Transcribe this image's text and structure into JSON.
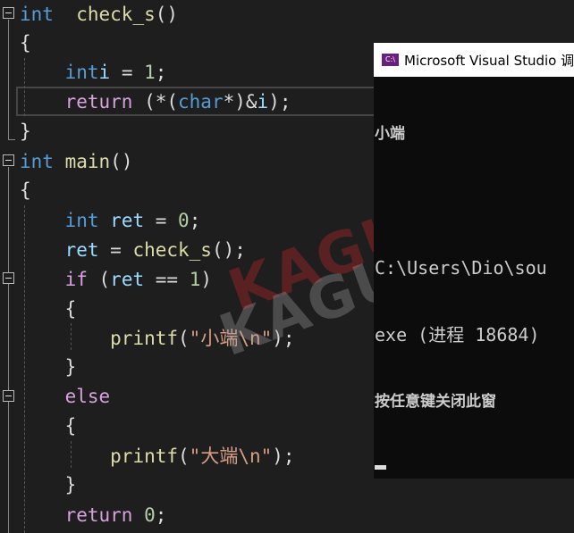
{
  "editor": {
    "lines": [
      [
        [
          "kw",
          "int"
        ],
        [
          "",
          "  "
        ],
        [
          "fn",
          "check_s"
        ],
        [
          "",
          "()"
        ]
      ],
      [
        [
          "",
          "{"
        ]
      ],
      [
        [
          "",
          "    "
        ],
        [
          "kw",
          "int"
        ],
        [
          "",
          "",
          " "
        ],
        [
          "var",
          "i"
        ],
        [
          "",
          " = "
        ],
        [
          "num",
          "1"
        ],
        [
          "",
          ";"
        ]
      ],
      [
        [
          "",
          "    "
        ],
        [
          "ctl",
          "return"
        ],
        [
          "",
          " (*("
        ],
        [
          "kw",
          "char"
        ],
        [
          "",
          "*)&"
        ],
        [
          "var",
          "i"
        ],
        [
          "",
          ");"
        ]
      ],
      [
        [
          "",
          "}"
        ]
      ],
      [
        [
          "kw",
          "int"
        ],
        [
          "",
          " "
        ],
        [
          "fn",
          "main"
        ],
        [
          "",
          "()"
        ]
      ],
      [
        [
          "",
          "{"
        ]
      ],
      [
        [
          "",
          "    "
        ],
        [
          "kw",
          "int"
        ],
        [
          "",
          " "
        ],
        [
          "var",
          "ret"
        ],
        [
          "",
          " = "
        ],
        [
          "num",
          "0"
        ],
        [
          "",
          ";"
        ]
      ],
      [
        [
          "",
          "    "
        ],
        [
          "var",
          "ret"
        ],
        [
          "",
          " = "
        ],
        [
          "fn",
          "check_s"
        ],
        [
          "",
          "();"
        ]
      ],
      [
        [
          "",
          "    "
        ],
        [
          "ctl",
          "if"
        ],
        [
          "",
          " ("
        ],
        [
          "var",
          "ret"
        ],
        [
          "",
          " == "
        ],
        [
          "num",
          "1"
        ],
        [
          "",
          ")"
        ]
      ],
      [
        [
          "",
          "    {"
        ]
      ],
      [
        [
          "",
          "        "
        ],
        [
          "fn",
          "printf"
        ],
        [
          "",
          "("
        ],
        [
          "str",
          "\"小端\\n\""
        ],
        [
          "",
          ");"
        ]
      ],
      [
        [
          "",
          "    }"
        ]
      ],
      [
        [
          "",
          "    "
        ],
        [
          "ctl",
          "else"
        ]
      ],
      [
        [
          "",
          "    {"
        ]
      ],
      [
        [
          "",
          "        "
        ],
        [
          "fn",
          "printf"
        ],
        [
          "",
          "("
        ],
        [
          "str",
          "\"大端\\n\""
        ],
        [
          "",
          ");"
        ]
      ],
      [
        [
          "",
          "    }"
        ]
      ],
      [
        [
          "",
          "    "
        ],
        [
          "ctl",
          "return"
        ],
        [
          "",
          " "
        ],
        [
          "num",
          "0"
        ],
        [
          "",
          ";"
        ]
      ]
    ],
    "watermark": "KAGUYA"
  },
  "console": {
    "title": "Microsoft Visual Studio 调",
    "icon": "visual-studio-console-icon",
    "output": [
      "小端",
      "",
      "C:\\Users\\Dio\\sou",
      "exe (进程 18684)",
      "按任意键关闭此窗"
    ]
  },
  "colors": {
    "keyword": "#569cd6",
    "function": "#dcdcaa",
    "control": "#d8a0df",
    "number": "#b5cea8",
    "string": "#d69d85",
    "variable": "#9cdcfe",
    "background": "#1e1e1e"
  }
}
